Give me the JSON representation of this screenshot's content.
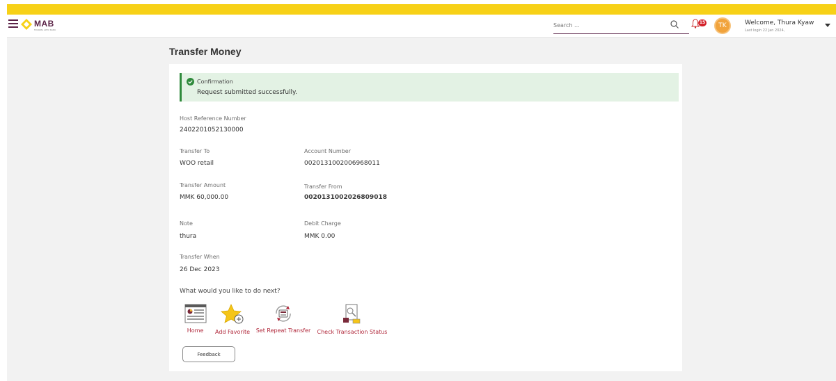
{
  "brand": {
    "name": "MAB",
    "tagline": "MYANMA APEX BANK"
  },
  "header": {
    "search_placeholder": "Search ...",
    "notification_count": "15",
    "avatar_initials": "TK",
    "welcome_text": "Welcome, Thura Kyaw",
    "last_login": "Last login 22 Jan 2024,"
  },
  "page": {
    "title": "Transfer Money"
  },
  "alert": {
    "title": "Confirmation",
    "message": "Request submitted successfully."
  },
  "details": {
    "host_ref_label": "Host Reference Number",
    "host_ref_value": "2402201052130000",
    "transfer_to_label": "Transfer To",
    "transfer_to_value": "WOO retail",
    "account_number_label": "Account Number",
    "account_number_value": "0020131002006968011",
    "transfer_amount_label": "Transfer Amount",
    "transfer_amount_value": "MMK 60,000.00",
    "transfer_from_label": "Transfer From",
    "transfer_from_value": "0020131002026809018",
    "note_label": "Note",
    "note_value": "thura",
    "debit_charge_label": "Debit Charge",
    "debit_charge_value": "MMK 0.00",
    "transfer_when_label": "Transfer When",
    "transfer_when_value": "26 Dec 2023"
  },
  "next": {
    "question": "What would you like to do next?",
    "actions": [
      {
        "label": "Home",
        "icon": "home-dashboard-icon"
      },
      {
        "label": "Add Favorite",
        "icon": "star-add-icon"
      },
      {
        "label": "Set Repeat Transfer",
        "icon": "repeat-transfer-icon"
      },
      {
        "label": "Check Transaction Status",
        "icon": "transaction-status-icon"
      }
    ]
  },
  "feedback_label": "Feedback",
  "colors": {
    "accent_yellow": "#f7d117",
    "brand_maroon": "#5b2347",
    "link_red": "#b0273a",
    "success_green": "#2f8a3c"
  }
}
